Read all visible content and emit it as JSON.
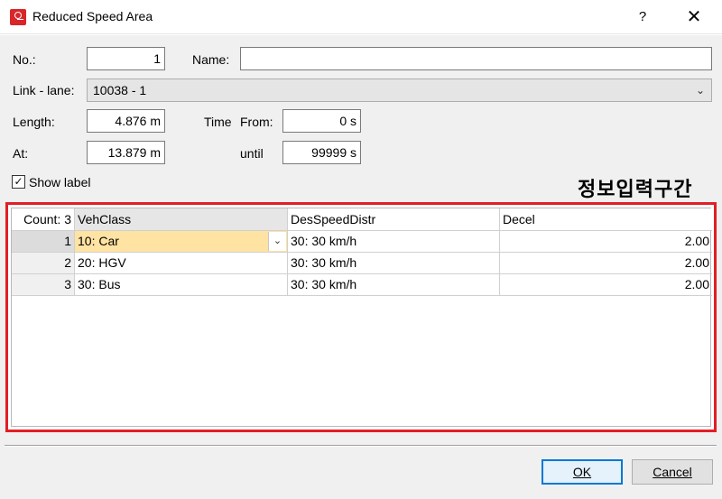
{
  "window": {
    "title": "Reduced Speed Area",
    "help_label": "?",
    "close_label": "✕"
  },
  "form": {
    "no_label": "No.:",
    "no_value": "1",
    "name_label": "Name:",
    "name_value": "",
    "link_lane_label": "Link - lane:",
    "link_lane_value": "10038 - 1",
    "length_label": "Length:",
    "length_value": "4.876 m",
    "time_label": "Time",
    "from_label": "From:",
    "from_value": "0 s",
    "at_label": "At:",
    "at_value": "13.879 m",
    "until_label": "until",
    "until_value": "99999 s",
    "show_label_text": "Show label",
    "show_label_checked": true
  },
  "annotation": {
    "text": "정보입력구간",
    "color": "#e31e24"
  },
  "grid": {
    "count_label": "Count: 3",
    "columns": [
      "VehClass",
      "DesSpeedDistr",
      "Decel"
    ],
    "rows": [
      {
        "num": "1",
        "vehclass": "10: Car",
        "desspeed": "30: 30 km/h",
        "decel": "2.00"
      },
      {
        "num": "2",
        "vehclass": "20: HGV",
        "desspeed": "30: 30 km/h",
        "decel": "2.00"
      },
      {
        "num": "3",
        "vehclass": "30: Bus",
        "desspeed": "30: 30 km/h",
        "decel": "2.00"
      }
    ]
  },
  "buttons": {
    "ok_label": "OK",
    "cancel_label": "Cancel"
  },
  "colors": {
    "highlight_border": "#e31e24",
    "active_cell": "#ffe3a3",
    "default_button_border": "#0078d7"
  }
}
